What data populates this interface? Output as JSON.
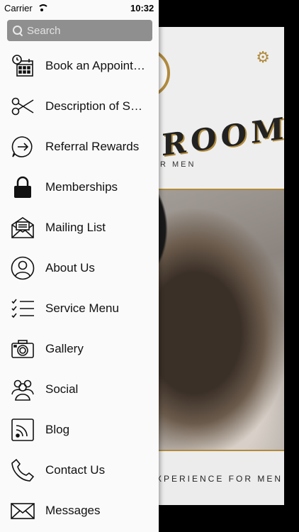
{
  "status_bar": {
    "carrier": "Carrier",
    "time": "10:32"
  },
  "search": {
    "placeholder": "Search"
  },
  "menu": [
    {
      "label": "Book an Appointment",
      "icon": "calendar-clock-icon"
    },
    {
      "label": "Description of Services",
      "icon": "scissors-icon"
    },
    {
      "label": "Referral Rewards",
      "icon": "arrow-bubble-icon"
    },
    {
      "label": "Memberships",
      "icon": "lock-icon"
    },
    {
      "label": "Mailing List",
      "icon": "mail-open-icon"
    },
    {
      "label": "About Us",
      "icon": "person-circle-icon"
    },
    {
      "label": "Service Menu",
      "icon": "checklist-icon"
    },
    {
      "label": "Gallery",
      "icon": "camera-icon"
    },
    {
      "label": "Social",
      "icon": "people-icon"
    },
    {
      "label": "Blog",
      "icon": "rss-icon"
    },
    {
      "label": "Contact Us",
      "icon": "phone-icon"
    },
    {
      "label": "Messages",
      "icon": "envelope-icon"
    }
  ],
  "background": {
    "logo_text": "ROOM",
    "subtitle": "R MEN",
    "footer_text": "XPERIENCE FOR MEN"
  },
  "colors": {
    "accent": "#b08a3c",
    "search_bg": "#8f8f8f",
    "drawer_bg": "#fafafa"
  }
}
